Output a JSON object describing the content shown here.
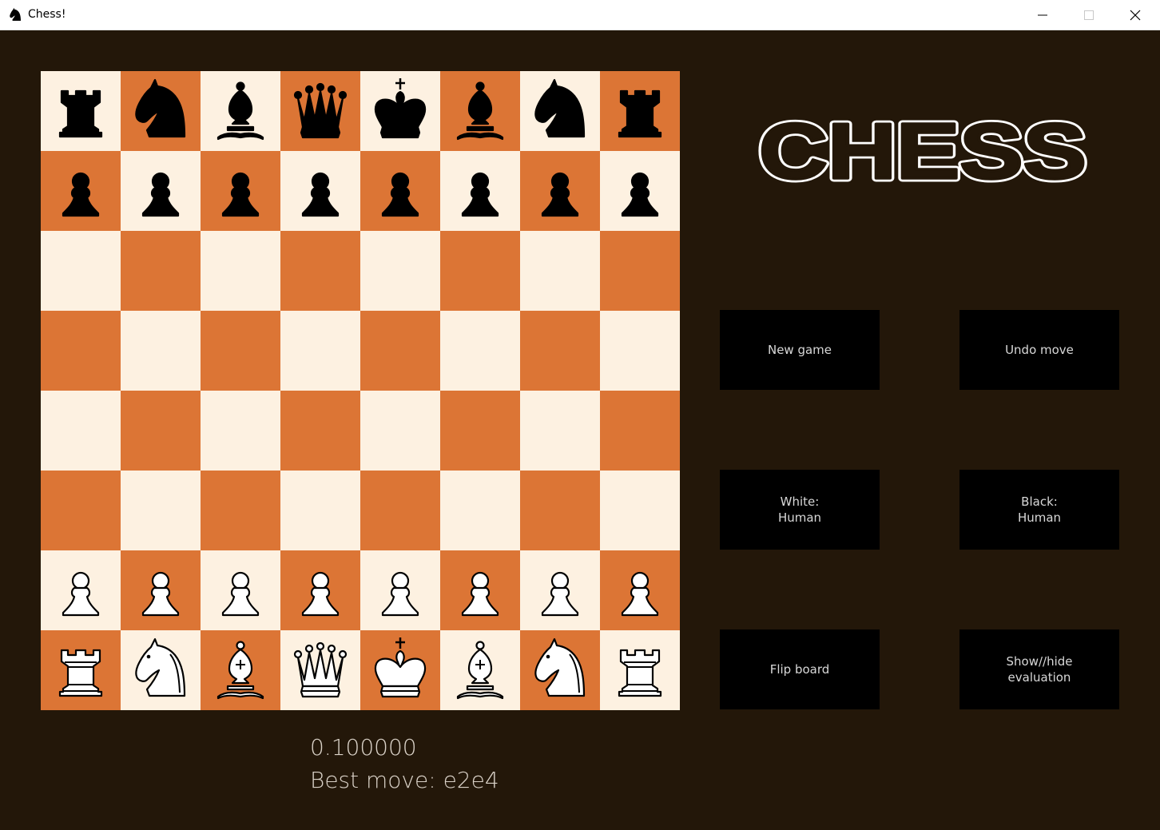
{
  "window": {
    "title": "Chess!",
    "controls": [
      "minimize-icon",
      "maximize-icon",
      "close-icon"
    ]
  },
  "logo_text": "CHESS",
  "colors": {
    "background": "#231709",
    "light_square": "#fdf1e1",
    "dark_square": "#dc7535",
    "button_bg": "#000000",
    "button_text": "#d8d8d8"
  },
  "board": {
    "ranks": [
      [
        "br",
        "bn",
        "bb",
        "bq",
        "bk",
        "bb",
        "bn",
        "br"
      ],
      [
        "bp",
        "bp",
        "bp",
        "bp",
        "bp",
        "bp",
        "bp",
        "bp"
      ],
      [
        "",
        "",
        "",
        "",
        "",
        "",
        "",
        ""
      ],
      [
        "",
        "",
        "",
        "",
        "",
        "",
        "",
        ""
      ],
      [
        "",
        "",
        "",
        "",
        "",
        "",
        "",
        ""
      ],
      [
        "",
        "",
        "",
        "",
        "",
        "",
        "",
        ""
      ],
      [
        "wp",
        "wp",
        "wp",
        "wp",
        "wp",
        "wp",
        "wp",
        "wp"
      ],
      [
        "wr",
        "wn",
        "wb",
        "wq",
        "wk",
        "wb",
        "wn",
        "wr"
      ]
    ]
  },
  "buttons": {
    "new_game": "New game",
    "undo_move": "Undo move",
    "white_player": "White:\nHuman",
    "black_player": "Black:\nHuman",
    "flip_board": "Flip board",
    "show_hide_eval": "Show//hide\nevaluation"
  },
  "evaluation": {
    "score": "0.100000",
    "best_move": "Best move: e2e4"
  }
}
